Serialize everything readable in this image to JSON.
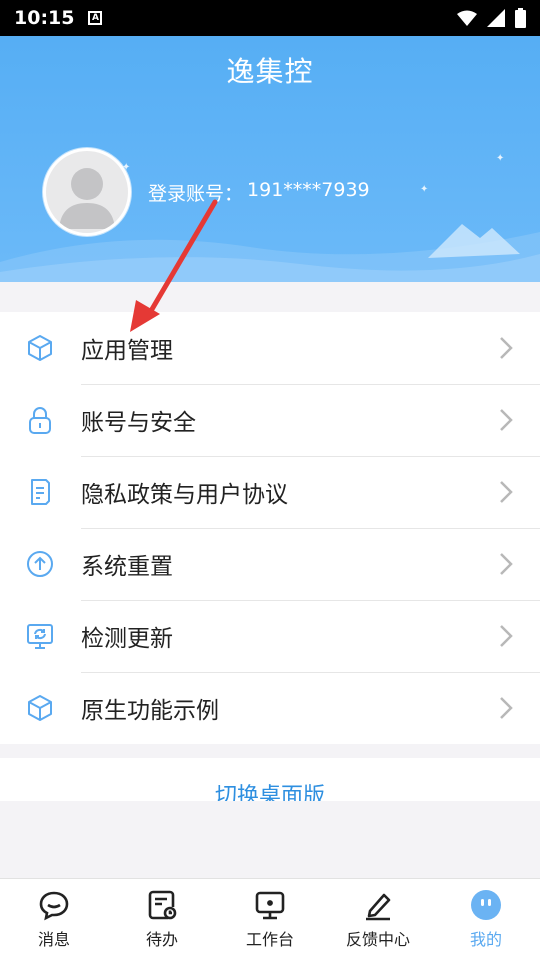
{
  "status_bar": {
    "time": "10:15",
    "notif_icon": "A"
  },
  "header": {
    "title": "逸集控",
    "account_label": "登录账号：",
    "account_value": "191****7939"
  },
  "menu": {
    "items": [
      {
        "label": "应用管理",
        "icon": "cube-icon"
      },
      {
        "label": "账号与安全",
        "icon": "lock-icon"
      },
      {
        "label": "隐私政策与用户协议",
        "icon": "document-icon"
      },
      {
        "label": "系统重置",
        "icon": "arrow-up-circle-icon"
      },
      {
        "label": "检测更新",
        "icon": "refresh-monitor-icon"
      },
      {
        "label": "原生功能示例",
        "icon": "cube-icon"
      }
    ]
  },
  "switch_desktop": "切换桌面版",
  "bottom_nav": {
    "items": [
      {
        "label": "消息",
        "icon": "chat-bubble-icon",
        "active": false
      },
      {
        "label": "待办",
        "icon": "todo-icon",
        "active": false
      },
      {
        "label": "工作台",
        "icon": "workbench-icon",
        "active": false
      },
      {
        "label": "反馈中心",
        "icon": "pen-icon",
        "active": false
      },
      {
        "label": "我的",
        "icon": "profile-face-icon",
        "active": true
      }
    ]
  },
  "colors": {
    "header_blue": "#5fb2f6",
    "accent_blue": "#5aa9f0",
    "link_blue": "#2e8fe0",
    "annotation_red": "#e53935"
  }
}
